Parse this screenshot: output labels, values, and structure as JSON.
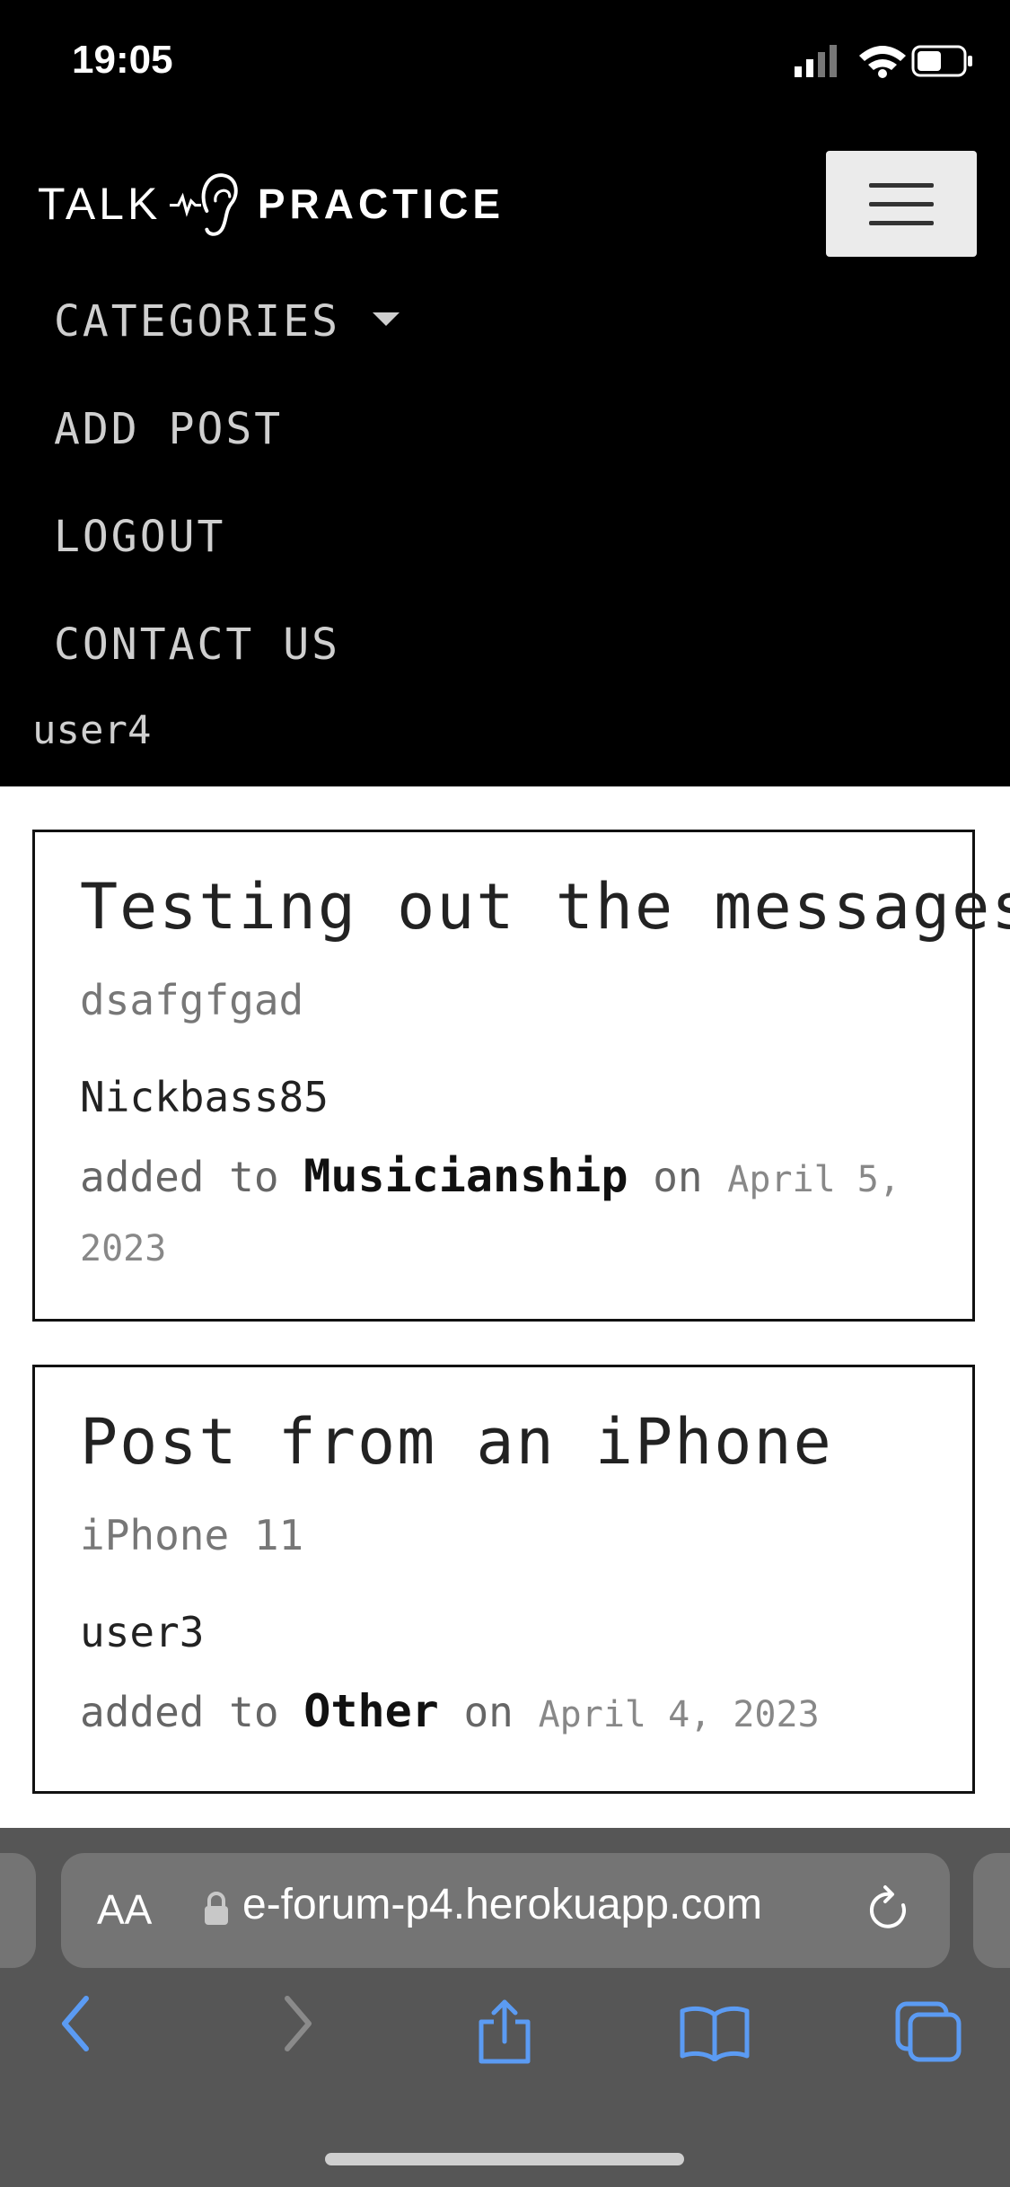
{
  "status": {
    "time": "19:05"
  },
  "brand": {
    "left": "TALK",
    "right": "PRACTICE"
  },
  "nav": {
    "items": [
      "CATEGORIES",
      "ADD POST",
      "LOGOUT",
      "CONTACT US"
    ],
    "user": "user4"
  },
  "posts": [
    {
      "title": "Testing out the messages",
      "excerpt": "dsafgfgad",
      "author": "Nickbass85",
      "meta_prefix": "added to",
      "category": "Musicianship",
      "meta_on": "on",
      "date": "April 5, 2023"
    },
    {
      "title": "Post from an iPhone",
      "excerpt": "iPhone 11",
      "author": "user3",
      "meta_prefix": "added to",
      "category": "Other",
      "meta_on": "on",
      "date": "April 4, 2023"
    }
  ],
  "browser": {
    "aa_label": "AA",
    "url": "e-forum-p4.herokuapp.com"
  },
  "colors": {
    "nav_bg": "#000000",
    "safari_bar": "#565656",
    "safari_icon": "#5b9bf3"
  }
}
